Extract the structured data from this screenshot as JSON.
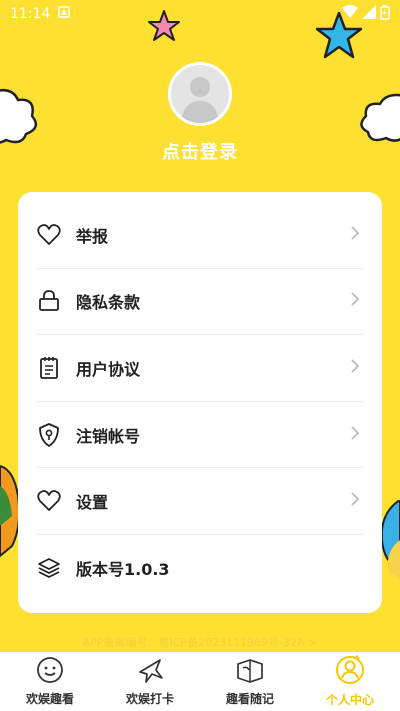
{
  "status_bar": {
    "time": "11:14"
  },
  "profile": {
    "login_label": "点击登录"
  },
  "menu": [
    {
      "label": "举报",
      "icon": "heart-icon",
      "has_chevron": true
    },
    {
      "label": "隐私条款",
      "icon": "lock-icon",
      "has_chevron": true
    },
    {
      "label": "用户协议",
      "icon": "document-icon",
      "has_chevron": true
    },
    {
      "label": "注销帐号",
      "icon": "shield-key-icon",
      "has_chevron": true
    },
    {
      "label": "设置",
      "icon": "heart-icon",
      "has_chevron": true
    },
    {
      "label": "版本号1.0.3",
      "icon": "layers-icon",
      "has_chevron": false
    }
  ],
  "footer": {
    "beian": "APP备案编号：粤ICP备2023111969号-32A >"
  },
  "tabs": [
    {
      "label": "欢娱趣看",
      "icon": "smiley-icon",
      "active": false
    },
    {
      "label": "欢娱打卡",
      "icon": "plane-icon",
      "active": false
    },
    {
      "label": "趣看随记",
      "icon": "hand-book-icon",
      "active": false
    },
    {
      "label": "个人中心",
      "icon": "person-icon",
      "active": true
    }
  ],
  "colors": {
    "background": "#fde032",
    "active_tab": "#f5c800",
    "card": "#ffffff"
  }
}
